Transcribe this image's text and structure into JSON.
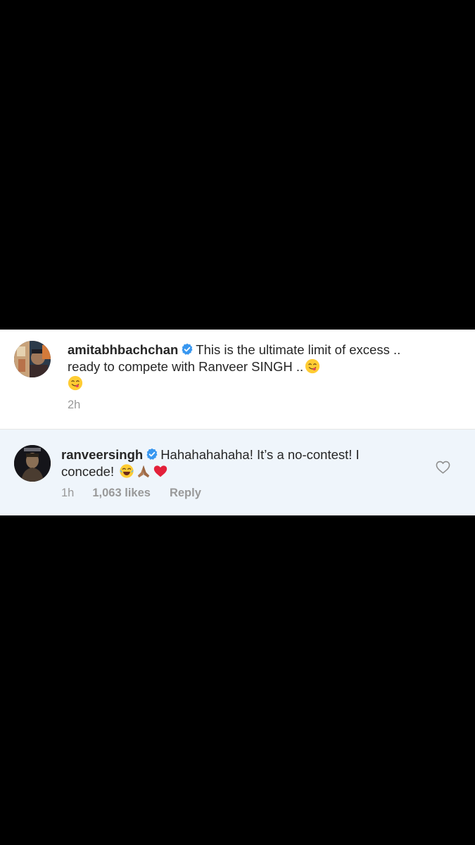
{
  "comments": [
    {
      "username": "amitabhbachchan",
      "verified": true,
      "text_part1": "This is the ultimate limit of excess .. ready to compete with Ranveer SINGH ..",
      "emojis": [
        "savoring-face-emoji",
        "savoring-face-emoji"
      ],
      "time": "2h"
    },
    {
      "username": "ranveersingh",
      "verified": true,
      "text_part1": "Hahahahahaha! It’s a no-contest! I concede!",
      "emojis": [
        "tears-of-joy-emoji",
        "folded-hands-emoji",
        "red-heart-emoji"
      ],
      "time": "1h",
      "likes": "1,063 likes",
      "reply_label": "Reply",
      "like_icon": "heart-outline-icon"
    }
  ],
  "colors": {
    "background": "#000000",
    "comment_bg": "#ffffff",
    "reply_bg": "#eff5fb",
    "verified_blue": "#3897f0",
    "meta_gray": "#999999"
  }
}
